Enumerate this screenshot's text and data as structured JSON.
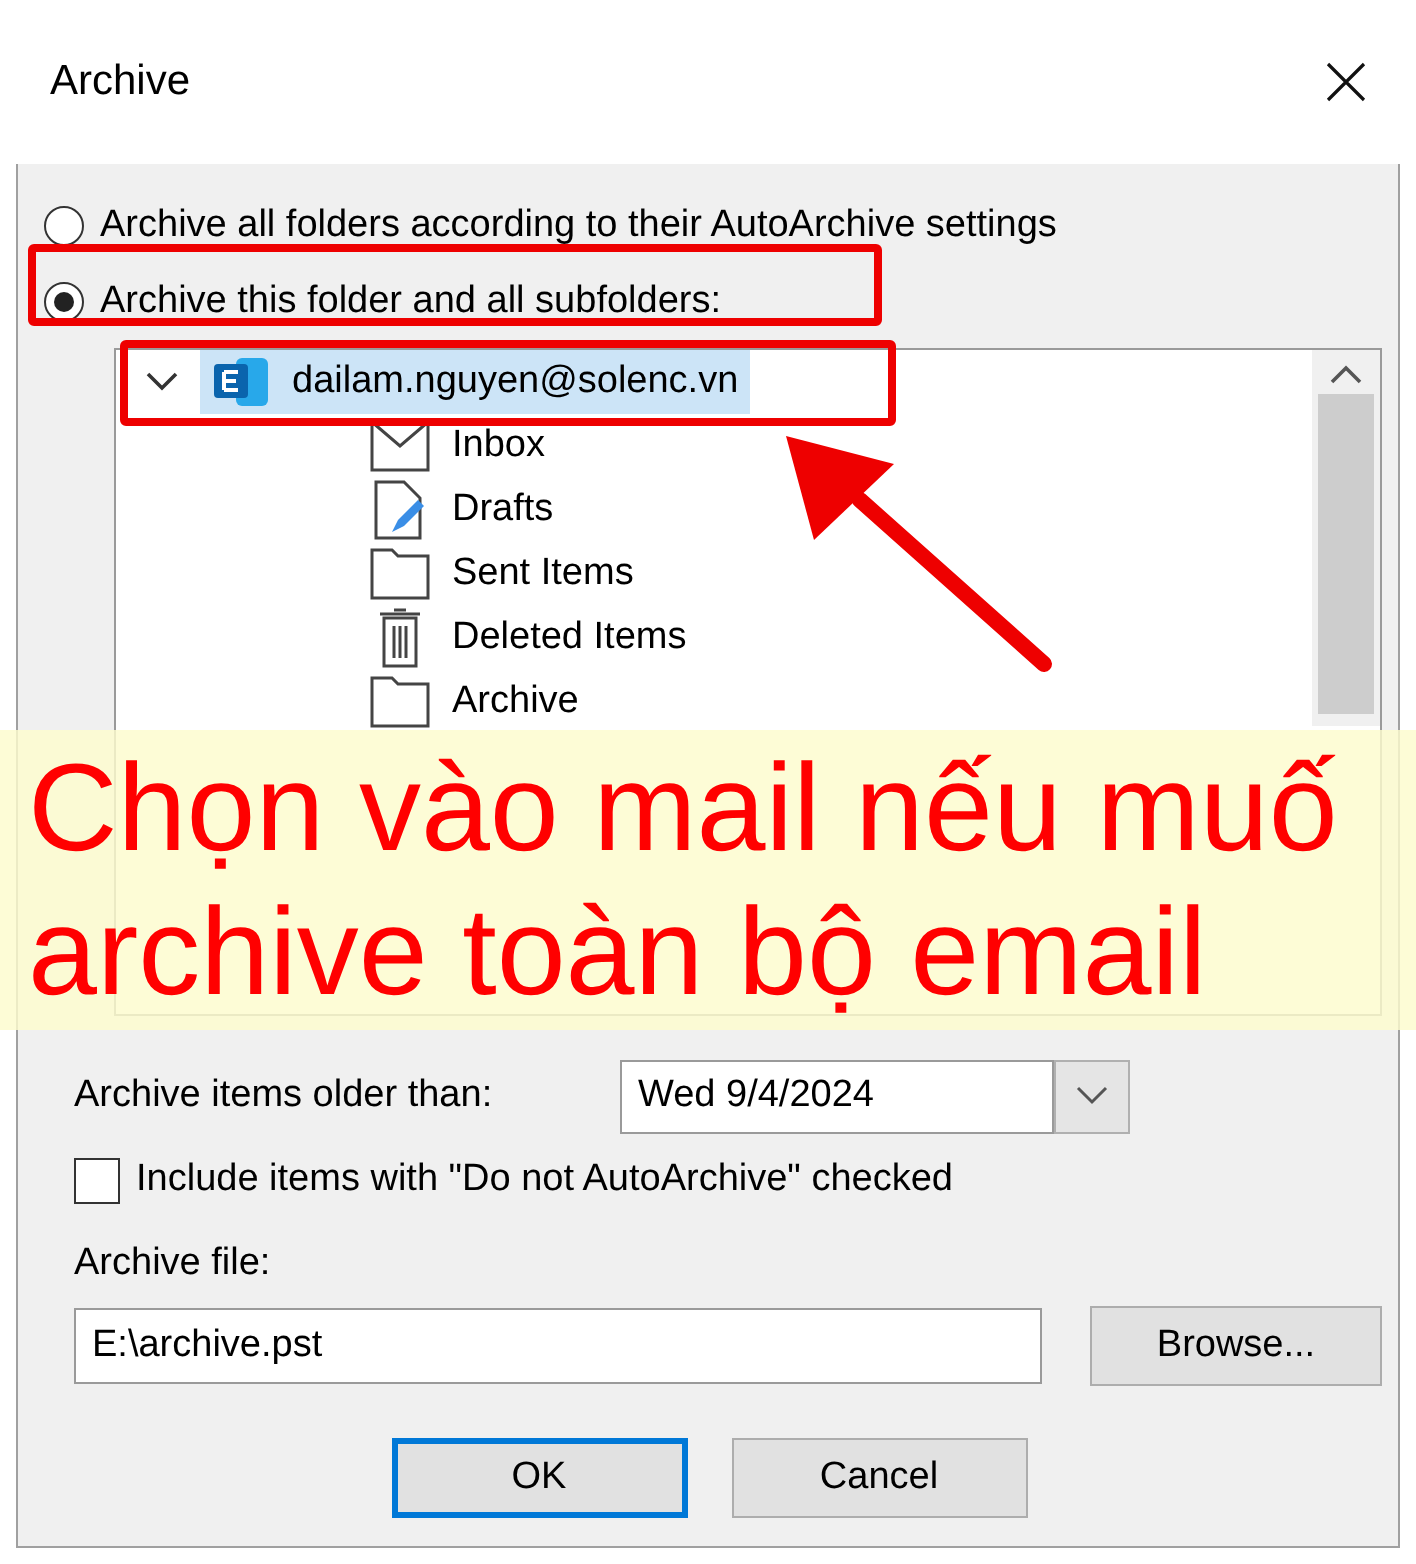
{
  "window": {
    "title": "Archive"
  },
  "archive_options": [
    {
      "label": "Archive all folders according to their AutoArchive settings",
      "selected": false
    },
    {
      "label": "Archive this folder and all subfolders:",
      "selected": true
    }
  ],
  "folder_tree": {
    "label": "dailam.nguyen@solenc.vn",
    "expanded": true,
    "selected": true,
    "children": [
      {
        "label": "Inbox",
        "kind": "inbox",
        "expandable": false
      },
      {
        "label": "Drafts",
        "kind": "drafts",
        "expandable": false
      },
      {
        "label": "Sent Items",
        "kind": "folder",
        "expandable": false
      },
      {
        "label": "Deleted Items",
        "kind": "trash",
        "expandable": false
      },
      {
        "label": "Archive",
        "kind": "folder",
        "expandable": false
      }
    ]
  },
  "older_than": {
    "label": "Archive items older than:",
    "value": "Wed 9/4/2024"
  },
  "include_option": {
    "label": "Include items with \"Do not AutoArchive\" checked",
    "checked": false
  },
  "archive_file": {
    "label": "Archive file:",
    "value": "E:\\archive.pst",
    "browse_button": "Browse..."
  },
  "buttons": [
    {
      "label": "OK",
      "default": true
    },
    {
      "label": "Cancel",
      "default": false
    }
  ],
  "annotation": {
    "lines": [
      "Chọn vào mail nếu muố",
      "archive toàn bộ email"
    ]
  }
}
